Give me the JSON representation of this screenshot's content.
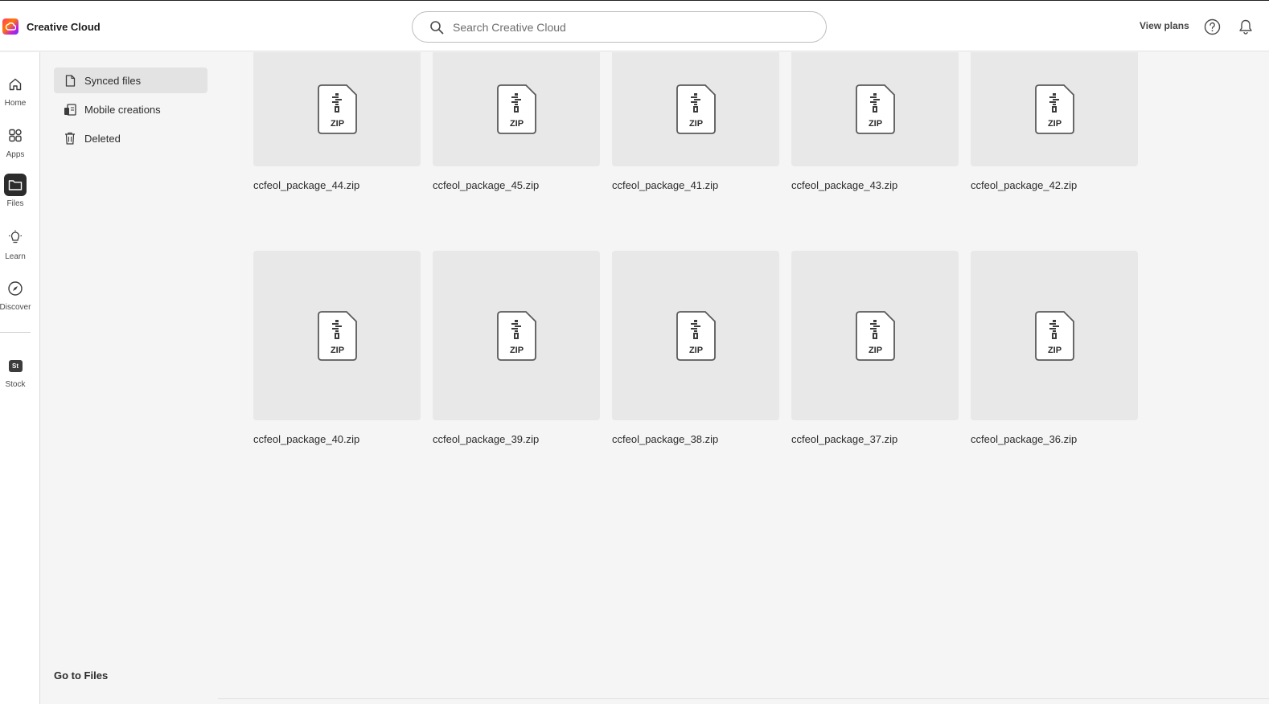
{
  "app": {
    "title": "Creative Cloud",
    "accent_color": "#e34850",
    "active_color": "#2c2c2c"
  },
  "header": {
    "search_placeholder": "Search Creative Cloud",
    "view_plans_label": "View plans",
    "help_icon": "help-circle-icon",
    "bell_icon": "bell-icon"
  },
  "rail": {
    "items": [
      {
        "label": "Home",
        "icon": "home-icon",
        "active": false
      },
      {
        "label": "Apps",
        "icon": "apps-grid-icon",
        "active": false
      },
      {
        "label": "Files",
        "icon": "folder-icon",
        "active": true
      },
      {
        "label": "Learn",
        "icon": "lightbulb-icon",
        "active": false
      },
      {
        "label": "Discover",
        "icon": "compass-icon",
        "active": false
      },
      {
        "label": "Stock",
        "icon": "stock-icon",
        "active": false,
        "badge": "St"
      }
    ]
  },
  "subnav": {
    "items": [
      {
        "label": "Synced files",
        "icon": "document-icon",
        "active": true
      },
      {
        "label": "Mobile creations",
        "icon": "devices-icon",
        "active": false
      },
      {
        "label": "Deleted",
        "icon": "trash-icon",
        "active": false
      }
    ],
    "goto_files": "Go to Files"
  },
  "files": {
    "type_label": "ZIP",
    "row1": [
      {
        "name": "ccfeol_package_44.zip"
      },
      {
        "name": "ccfeol_package_45.zip"
      },
      {
        "name": "ccfeol_package_41.zip"
      },
      {
        "name": "ccfeol_package_43.zip"
      },
      {
        "name": "ccfeol_package_42.zip"
      }
    ],
    "row2": [
      {
        "name": "ccfeol_package_40.zip"
      },
      {
        "name": "ccfeol_package_39.zip"
      },
      {
        "name": "ccfeol_package_38.zip"
      },
      {
        "name": "ccfeol_package_37.zip"
      },
      {
        "name": "ccfeol_package_36.zip"
      }
    ]
  }
}
